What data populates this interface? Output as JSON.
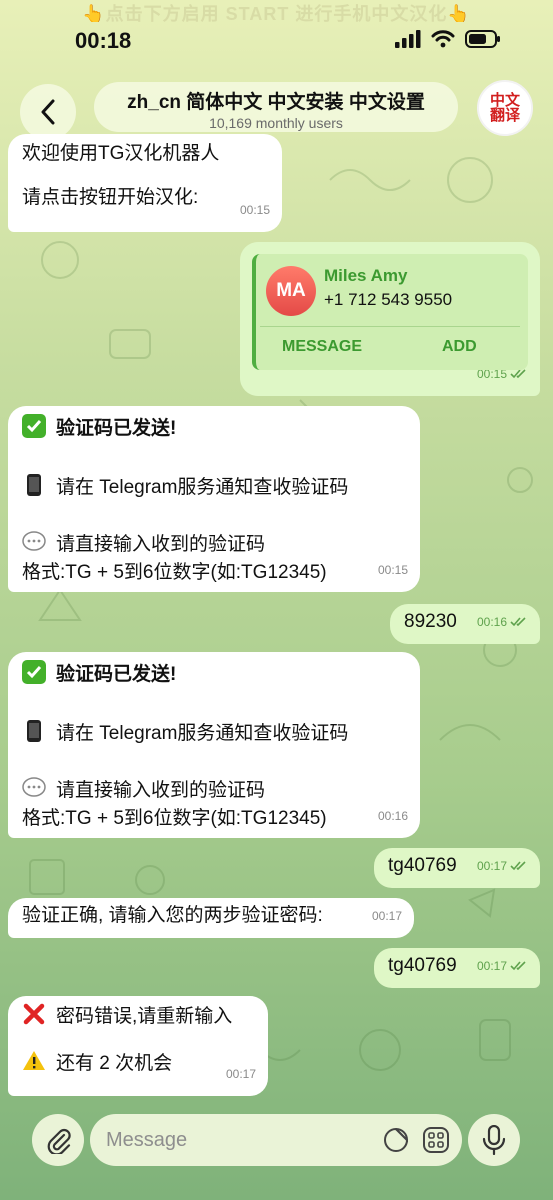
{
  "status_bar": {
    "banner": "👆点击下方启用 START 进行手机中文汉化👆",
    "time": "00:18"
  },
  "header": {
    "back_icon": "chevron-left-icon",
    "title": "zh_cn 简体中文 中文安装 中文设置",
    "subtitle": "10,169 monthly users",
    "logo_line1": "中文",
    "logo_line2": "翻译"
  },
  "messages": [
    {
      "id": "m1",
      "direction": "in",
      "lines": [
        "欢迎使用TG汉化机器人",
        "",
        "请点击按钮开始汉化:"
      ],
      "time": "00:15"
    },
    {
      "id": "m2",
      "direction": "out",
      "type": "contact",
      "contact": {
        "initials": "MA",
        "name": "Miles Amy",
        "phone": "+1 712 543 9550",
        "message_label": "MESSAGE",
        "add_label": "ADD"
      },
      "time": "00:15"
    },
    {
      "id": "m3",
      "direction": "in",
      "lines": [
        "验证码已发送!",
        "",
        "请在 Telegram服务通知查收验证码",
        "",
        "请直接输入收到的验证码",
        "格式:TG + 5到6位数字(如:TG12345)"
      ],
      "time": "00:15"
    },
    {
      "id": "m4",
      "direction": "out",
      "lines": [
        "89230"
      ],
      "time": "00:16"
    },
    {
      "id": "m5",
      "direction": "in",
      "lines": [
        "验证码已发送!",
        "",
        "请在 Telegram服务通知查收验证码",
        "",
        "请直接输入收到的验证码",
        "格式:TG + 5到6位数字(如:TG12345)"
      ],
      "time": "00:16"
    },
    {
      "id": "m6",
      "direction": "out",
      "lines": [
        "tg40769"
      ],
      "time": "00:17"
    },
    {
      "id": "m7",
      "direction": "in",
      "lines": [
        "验证正确, 请输入您的两步验证密码:"
      ],
      "time": "00:17"
    },
    {
      "id": "m8",
      "direction": "out",
      "lines": [
        "tg40769"
      ],
      "time": "00:17"
    },
    {
      "id": "m9",
      "direction": "in",
      "lines": [
        "密码错误,请重新输入",
        "",
        "还有 2 次机会"
      ],
      "time": "00:17"
    }
  ],
  "input_bar": {
    "placeholder": "Message",
    "attach_icon": "paperclip-icon",
    "sticker_icon": "sticker-icon",
    "emoji_icon": "emoji-keyboard-icon",
    "mic_icon": "microphone-icon"
  },
  "colors": {
    "outgoing_bubble": "#dff7c6",
    "incoming_bubble": "#ffffff",
    "accent_green": "#3c9a30",
    "check_green": "#5fa24d",
    "check_red": "#e02424",
    "warn_yellow": "#f4c20d"
  }
}
